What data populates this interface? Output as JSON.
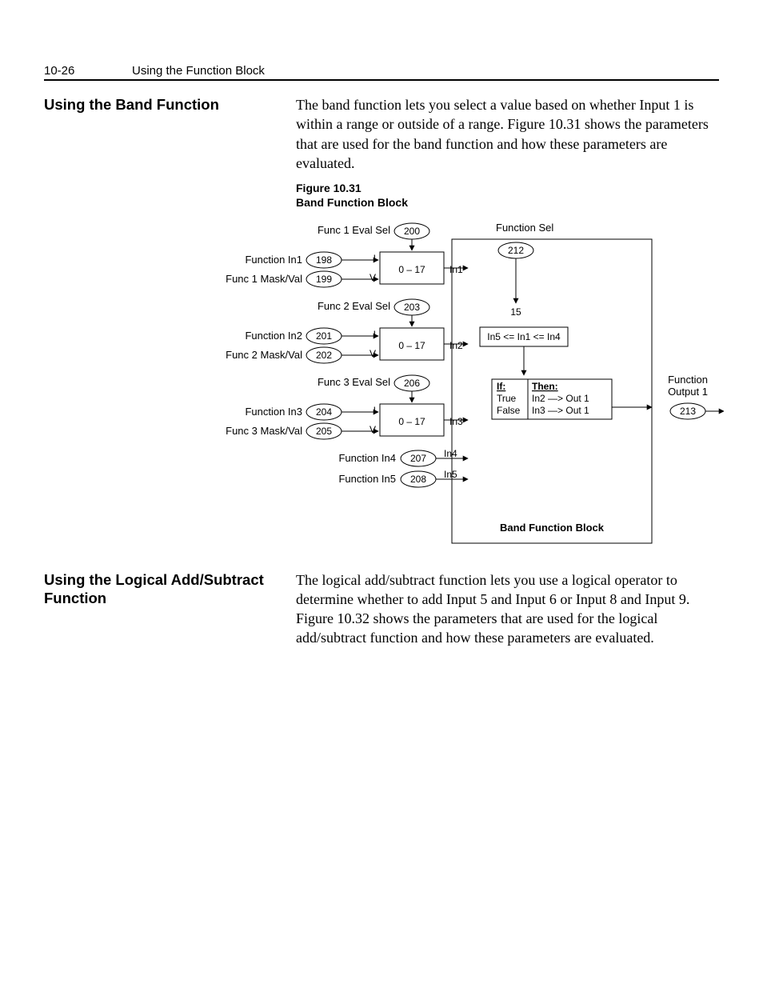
{
  "header": {
    "page_num": "10-26",
    "chapter": "Using the Function Block"
  },
  "section1": {
    "title": "Using the Band Function",
    "body": "The band function lets you select a value based on whether Input 1 is within a range or outside of a range. Figure 10.31 shows the parameters that are used for the band function and how these parameters are evaluated."
  },
  "figure": {
    "num": "Figure 10.31",
    "title": "Band Function Block",
    "footer": "Band Function Block",
    "params": {
      "f1_eval": {
        "label": "Func 1 Eval Sel",
        "id": "200"
      },
      "f1_in": {
        "label": "Function In1",
        "id": "198"
      },
      "f1_mask": {
        "label": "Func 1 Mask/Val",
        "id": "199"
      },
      "f2_eval": {
        "label": "Func 2 Eval Sel",
        "id": "203"
      },
      "f2_in": {
        "label": "Function In2",
        "id": "201"
      },
      "f2_mask": {
        "label": "Func 2 Mask/Val",
        "id": "202"
      },
      "f3_eval": {
        "label": "Func 3 Eval Sel",
        "id": "206"
      },
      "f3_in": {
        "label": "Function In3",
        "id": "204"
      },
      "f3_mask": {
        "label": "Func 3 Mask/Val",
        "id": "205"
      },
      "f4_in": {
        "label": "Function In4",
        "id": "207"
      },
      "f5_in": {
        "label": "Function In5",
        "id": "208"
      },
      "fsel": {
        "label": "Function Sel",
        "id": "212"
      },
      "fout": {
        "label1": "Function",
        "label2": "Output 1",
        "id": "213"
      }
    },
    "box": {
      "range": "0 – 17",
      "I": "I",
      "V": "V",
      "in1": "In1",
      "in2": "In2",
      "in3": "In3",
      "in4": "In4",
      "in5": "In5",
      "sel_val": "15",
      "cond": "In5 <= In1 <= In4",
      "if": "If:",
      "then": "Then:",
      "true": "True",
      "false": "False",
      "t_out": "In2 —> Out 1",
      "f_out": "In3 —> Out 1"
    }
  },
  "section2": {
    "title": "Using the Logical Add/Subtract Function",
    "body": "The logical add/subtract function lets you use a logical operator to determine whether to add Input 5 and Input 6 or Input 8 and Input 9. Figure 10.32 shows the parameters that are used for the logical add/subtract function and how these parameters are evaluated."
  }
}
